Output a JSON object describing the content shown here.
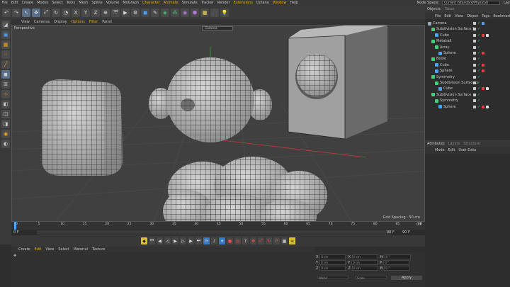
{
  "menubar": {
    "items": [
      {
        "label": "File",
        "hl": false
      },
      {
        "label": "Edit",
        "hl": false
      },
      {
        "label": "Create",
        "hl": false
      },
      {
        "label": "Modes",
        "hl": false
      },
      {
        "label": "Select",
        "hl": false
      },
      {
        "label": "Tools",
        "hl": false
      },
      {
        "label": "Mesh",
        "hl": false
      },
      {
        "label": "Spline",
        "hl": false
      },
      {
        "label": "Volume",
        "hl": false
      },
      {
        "label": "MoGraph",
        "hl": false
      },
      {
        "label": "Character",
        "hl": true
      },
      {
        "label": "Animate",
        "hl": true
      },
      {
        "label": "Simulate",
        "hl": false
      },
      {
        "label": "Tracker",
        "hl": false
      },
      {
        "label": "Render",
        "hl": false
      },
      {
        "label": "Extensions",
        "hl": true
      },
      {
        "label": "Octane",
        "hl": false
      },
      {
        "label": "Window",
        "hl": true
      },
      {
        "label": "Help",
        "hl": false
      }
    ],
    "node_space_label": "Node Space:",
    "node_space_value": "Current (Standard/Physical)",
    "layout_label": "Layout"
  },
  "toolbar": {
    "icons": [
      "undo-icon",
      "redo-icon",
      "live-select-icon",
      "move-icon",
      "scale-icon",
      "rotate-icon",
      "recent-icon",
      "x-axis-icon",
      "y-axis-icon",
      "z-axis-icon",
      "coordinate-system-icon",
      "render-view-icon",
      "render-picture-viewer-icon",
      "edit-render-settings-icon",
      "cube-icon",
      "pen-icon",
      "subdivision-icon",
      "cloner-icon",
      "field-icon",
      "deformer-icon",
      "scene-icon",
      "camera-icon",
      "light-icon"
    ],
    "glyphs": [
      "↶",
      "↷",
      "↖",
      "✥",
      "⤢",
      "↻",
      "◔",
      "X",
      "Y",
      "Z",
      "⊕",
      "🎬",
      "▶",
      "⚙",
      "◼",
      "✎",
      "◈",
      "⁂",
      "◉",
      "⬢",
      "▦",
      "🎥",
      "💡"
    ]
  },
  "left_tools": [
    "make-editable-icon",
    "model-mode-icon",
    "mesh-mode-icon",
    "points-mode-icon",
    "edges-mode-icon",
    "polygons-mode-icon",
    "uv-mode-icon",
    "axis-mode-icon",
    "snap-icon",
    "workplane-icon",
    "locked-workplane-icon",
    "solo-icon",
    "magnet-icon"
  ],
  "viewport": {
    "menu": [
      {
        "label": "View",
        "hl": false
      },
      {
        "label": "Cameras",
        "hl": false
      },
      {
        "label": "Display",
        "hl": false
      },
      {
        "label": "Options",
        "hl": true
      },
      {
        "label": "Filter",
        "hl": true
      },
      {
        "label": "Panel",
        "hl": false
      }
    ],
    "perspective_label": "Perspective",
    "camera_select": "Camera",
    "grid_spacing": "Grid Spacing : 50 cm"
  },
  "timeline": {
    "ticks": [
      "0",
      "5",
      "10",
      "15",
      "20",
      "25",
      "30",
      "35",
      "40",
      "45",
      "50",
      "55",
      "60",
      "65",
      "70",
      "75",
      "80",
      "85",
      "90"
    ],
    "start_frame": "0 F",
    "current_frame": "0 F",
    "end_frame": "90 F",
    "max_frame": "90 F",
    "right_frame": "0 F"
  },
  "materials": {
    "menu": [
      {
        "label": "Create",
        "hl": false
      },
      {
        "label": "Edit",
        "hl": true
      },
      {
        "label": "View",
        "hl": false
      },
      {
        "label": "Select",
        "hl": false
      },
      {
        "label": "Material",
        "hl": false
      },
      {
        "label": "Texture",
        "hl": false
      }
    ]
  },
  "coords": {
    "rows": [
      {
        "a": "X",
        "av": "0 cm",
        "b": "X",
        "bv": "0 cm",
        "c": "H",
        "cv": "0 °"
      },
      {
        "a": "Y",
        "av": "0 cm",
        "b": "Y",
        "bv": "0 cm",
        "c": "P",
        "cv": "0 °"
      },
      {
        "a": "Z",
        "av": "0 cm",
        "b": "Z",
        "bv": "0 cm",
        "c": "B",
        "cv": "0 °"
      }
    ],
    "world": "World",
    "scale": "Scale",
    "apply": "Apply"
  },
  "objects": {
    "tabs": [
      {
        "label": "Objects",
        "dim": false
      },
      {
        "label": "Takes",
        "dim": true
      }
    ],
    "menu": [
      "File",
      "Edit",
      "View",
      "Object",
      "Tags",
      "Bookmarks"
    ],
    "rows": [
      {
        "name": "Camera",
        "indent": 0,
        "color": "#9ab",
        "tags": [
          "#5aa0ff"
        ]
      },
      {
        "name": "Subdivision Surface.1",
        "indent": 1,
        "color": "#3fd07a",
        "tags": []
      },
      {
        "name": "Cube",
        "indent": 2,
        "color": "#4aa3ff",
        "tags": [
          "#e04040",
          "#e0e0e0"
        ]
      },
      {
        "name": "Metaball",
        "indent": 1,
        "color": "#3fd07a",
        "tags": []
      },
      {
        "name": "Array",
        "indent": 2,
        "color": "#3fd07a",
        "tags": []
      },
      {
        "name": "Sphere",
        "indent": 3,
        "color": "#4aa3ff",
        "tags": [
          "#e04040"
        ]
      },
      {
        "name": "Boole",
        "indent": 1,
        "color": "#3fd07a",
        "tags": []
      },
      {
        "name": "Cube",
        "indent": 2,
        "color": "#4aa3ff",
        "tags": [
          "#e04040"
        ]
      },
      {
        "name": "Sphere",
        "indent": 2,
        "color": "#4aa3ff",
        "tags": [
          "#e04040"
        ]
      },
      {
        "name": "Symmetry",
        "indent": 1,
        "color": "#3fd07a",
        "tags": []
      },
      {
        "name": "Subdivision Surface.1",
        "indent": 2,
        "color": "#3fd07a",
        "tags": []
      },
      {
        "name": "Cube",
        "indent": 3,
        "color": "#4aa3ff",
        "tags": [
          "#e04040",
          "#e0e0e0"
        ]
      },
      {
        "name": "Subdivision Surface",
        "indent": 1,
        "color": "#3fd07a",
        "tags": []
      },
      {
        "name": "Symmetry",
        "indent": 2,
        "color": "#3fd07a",
        "tags": []
      },
      {
        "name": "Sphere",
        "indent": 3,
        "color": "#4aa3ff",
        "tags": [
          "#e04040",
          "#e0e0e0"
        ]
      }
    ]
  },
  "attributes": {
    "tabs": [
      {
        "label": "Attributes",
        "dim": false
      },
      {
        "label": "Layers",
        "dim": true
      },
      {
        "label": "Structure",
        "dim": true
      }
    ],
    "menu": [
      "Mode",
      "Edit",
      "User Data"
    ]
  }
}
